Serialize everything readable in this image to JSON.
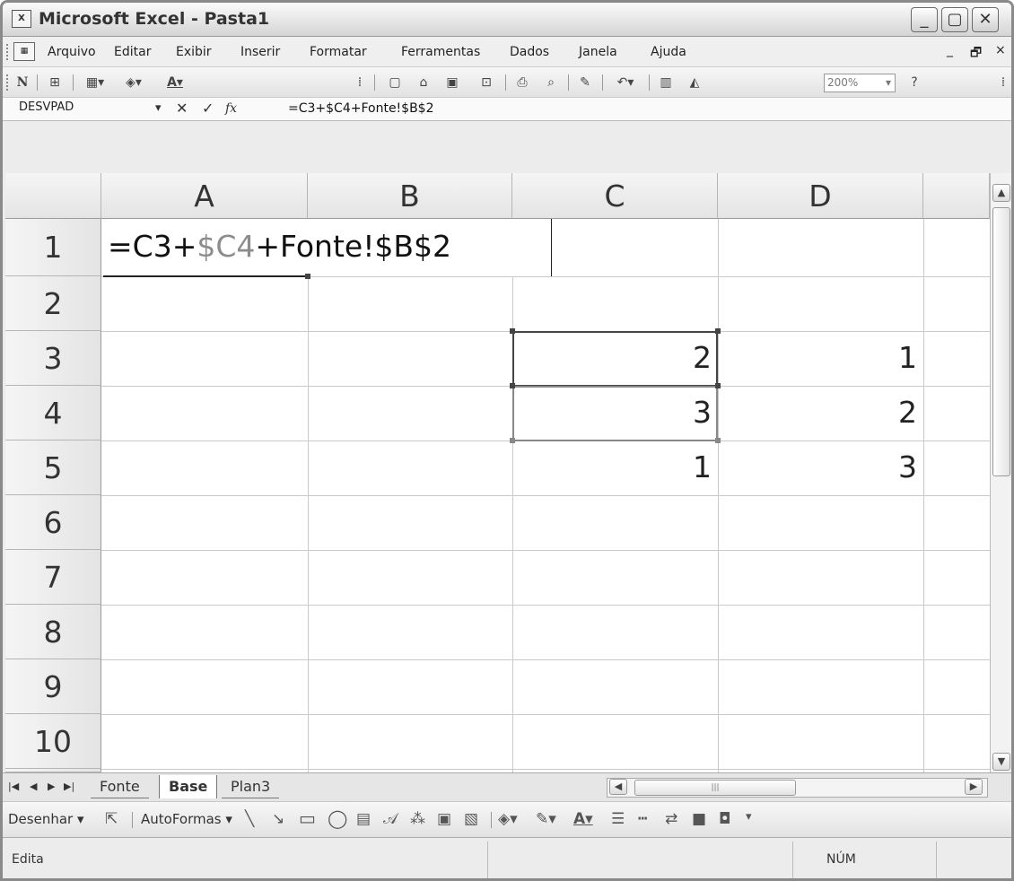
{
  "window": {
    "title": "Microsoft Excel - Pasta1",
    "controls": {
      "minimize": "_",
      "restore": "▢",
      "close": "✕"
    }
  },
  "menubar": {
    "items": [
      "Arquivo",
      "Editar",
      "Exibir",
      "Inserir",
      "Formatar",
      "Ferramentas",
      "Dados",
      "Janela",
      "Ajuda"
    ],
    "doc_controls": {
      "minimize": "_",
      "restore": "🗗",
      "close": "×"
    }
  },
  "toolbar": {
    "bold": "N",
    "zoom": "200%"
  },
  "formula_bar": {
    "name_box": "DESVPAD",
    "dropdown": "▾",
    "cancel": "✕",
    "enter": "✓",
    "fx": "fx",
    "content": "=C3+$C4+Fonte!$B$2"
  },
  "grid": {
    "columns": [
      "A",
      "B",
      "C",
      "D"
    ],
    "rows": [
      "1",
      "2",
      "3",
      "4",
      "5",
      "6",
      "7",
      "8",
      "9",
      "10"
    ],
    "edit": {
      "part1": "=C3+",
      "part2": "$C4",
      "part3": "+Fonte!$B$2"
    },
    "values": {
      "C3": "2",
      "C4": "3",
      "C5": "1",
      "D3": "1",
      "D4": "2",
      "D5": "3"
    }
  },
  "sheets": {
    "tabs": [
      "Fonte",
      "Base",
      "Plan3"
    ],
    "active": "Base"
  },
  "drawbar": {
    "draw": "Desenhar",
    "autoshapes": "AutoFormas"
  },
  "status": {
    "mode": "Edita",
    "num": "NÚM"
  }
}
